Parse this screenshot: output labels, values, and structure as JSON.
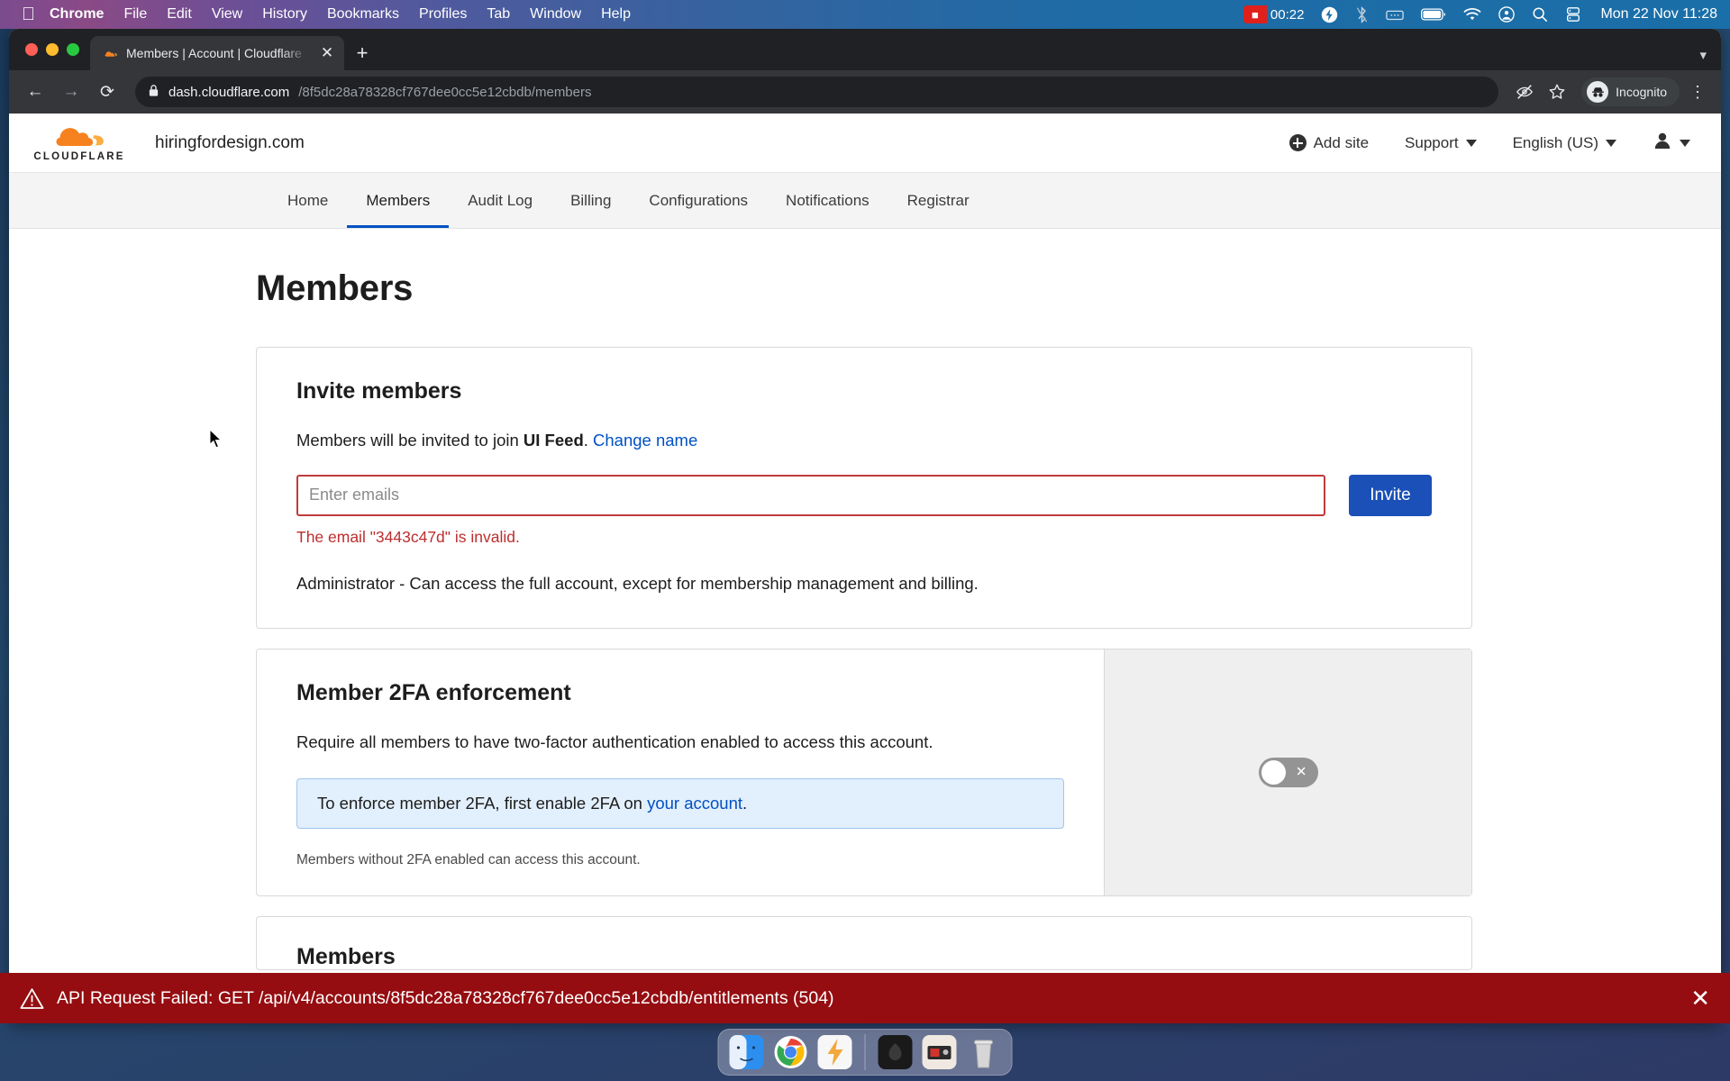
{
  "menubar": {
    "apple_icon": "apple-logo-icon",
    "items": [
      "Chrome",
      "File",
      "Edit",
      "View",
      "History",
      "Bookmarks",
      "Profiles",
      "Tab",
      "Window",
      "Help"
    ],
    "recording_time": "00:22",
    "status_icons": [
      "screen-recording-icon",
      "lightning-bolt-icon",
      "bluetooth-off-icon",
      "keyboard-brightness-icon",
      "battery-icon",
      "wifi-icon",
      "control-center-icon",
      "search-icon",
      "display-icon"
    ],
    "clock": "Mon 22 Nov  11:28"
  },
  "browser": {
    "tab": {
      "title": "Members | Account | Cloudflare",
      "favicon": "cloudflare-favicon",
      "close_label": "✕"
    },
    "new_tab_label": "+",
    "tabstrip_chevron": "▾",
    "nav": {
      "back": "←",
      "forward": "→",
      "reload": "⟳"
    },
    "omnibox": {
      "lock_icon": "lock-icon",
      "url_host": "dash.cloudflare.com",
      "url_path": "/8f5dc28a78328cf767dee0cc5e12cbdb/members"
    },
    "toolbar_right": {
      "hide_icon": "eye-slash-icon",
      "bookmark_icon": "star-icon",
      "profile_label": "Incognito",
      "menu_icon": "three-dot-menu-icon"
    }
  },
  "cloudflare": {
    "logo_wordmark": "CLOUDFLARE",
    "account_domain": "hiringfordesign.com",
    "header_actions": {
      "add_site": "Add site",
      "support": "Support",
      "language": "English (US)"
    },
    "nav_tabs": [
      {
        "label": "Home",
        "active": false
      },
      {
        "label": "Members",
        "active": true
      },
      {
        "label": "Audit Log",
        "active": false
      },
      {
        "label": "Billing",
        "active": false
      },
      {
        "label": "Configurations",
        "active": false
      },
      {
        "label": "Notifications",
        "active": false
      },
      {
        "label": "Registrar",
        "active": false
      }
    ],
    "page_title": "Members",
    "invite_card": {
      "heading": "Invite members",
      "description_prefix": "Members will be invited to join ",
      "account_name": "UI Feed",
      "description_suffix": ".",
      "change_name_link": "Change name",
      "email_placeholder": "Enter emails",
      "email_value": "",
      "invite_button": "Invite",
      "error_message": "The email \"3443c47d\" is invalid.",
      "role_description": "Administrator - Can access the full account, except for membership management and billing."
    },
    "twofa_card": {
      "heading": "Member 2FA enforcement",
      "description": "Require all members to have two-factor authentication enabled to access this account.",
      "info_prefix": "To enforce member 2FA, first enable 2FA on ",
      "info_link": "your account",
      "info_suffix": ".",
      "note": "Members without 2FA enabled can access this account.",
      "toggle_state": "off",
      "toggle_glyph": "✕"
    },
    "next_card_partial_heading": "Members"
  },
  "error_bar": {
    "icon": "warning-triangle-icon",
    "message": "API Request Failed: GET /api/v4/accounts/8f5dc28a78328cf767dee0cc5e12cbdb/entitlements (504)",
    "close_label": "✕"
  },
  "dock": {
    "items": [
      "finder-icon",
      "chrome-icon",
      "zap-icon",
      "app-dark-icon",
      "screenshot-icon",
      "trash-icon"
    ]
  },
  "colors": {
    "cloudflare_orange": "#f6821f",
    "primary_blue": "#1a50b8",
    "link_blue": "#0051c3",
    "error_red": "#bd2e2e",
    "error_bar_red": "#950d11",
    "info_blue_bg": "#e2effc"
  }
}
